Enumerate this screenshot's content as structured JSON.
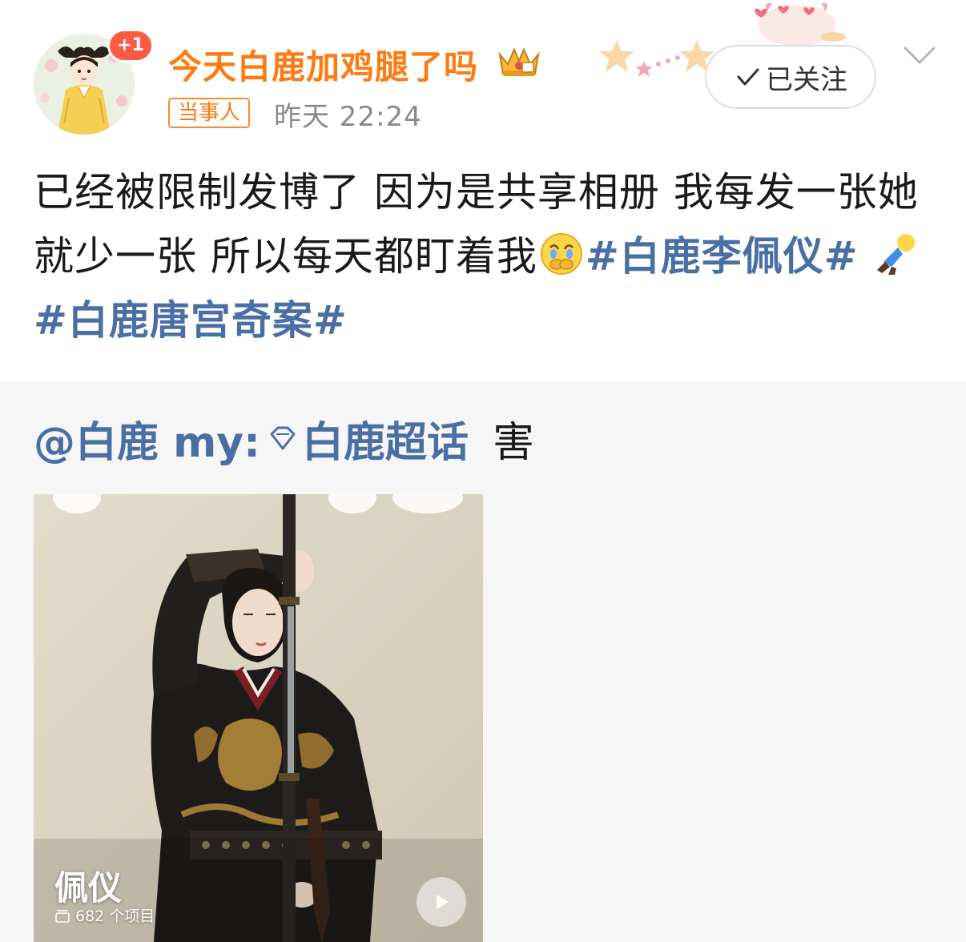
{
  "header": {
    "avatar_badge": "+1",
    "username": "今天白鹿加鸡腿了吗",
    "party_tag": "当事人",
    "timestamp": "昨天 22:24",
    "follow_label": "已关注",
    "crown_icon": "crown-icon",
    "username_color": "#ff7a12"
  },
  "post": {
    "text_1": "已经被限制发博了 因为是共享相册 我每发一张她就少一张 所以每天都盯着我",
    "hashtag_1": "#白鹿李佩仪#",
    "hashtag_2": "#白鹿唐宫奇案#",
    "emoji_1": "crying-covering-mouth-emoji",
    "emoji_2": "falling-person-emoji",
    "hashtag_color": "#4a6fa5"
  },
  "repost": {
    "mention": "@白鹿 my:",
    "supertopic_icon": "diamond-icon",
    "supertopic": "白鹿超话",
    "text": "害",
    "image": {
      "album_title": "佩仪",
      "item_count": "682 个项目"
    }
  }
}
